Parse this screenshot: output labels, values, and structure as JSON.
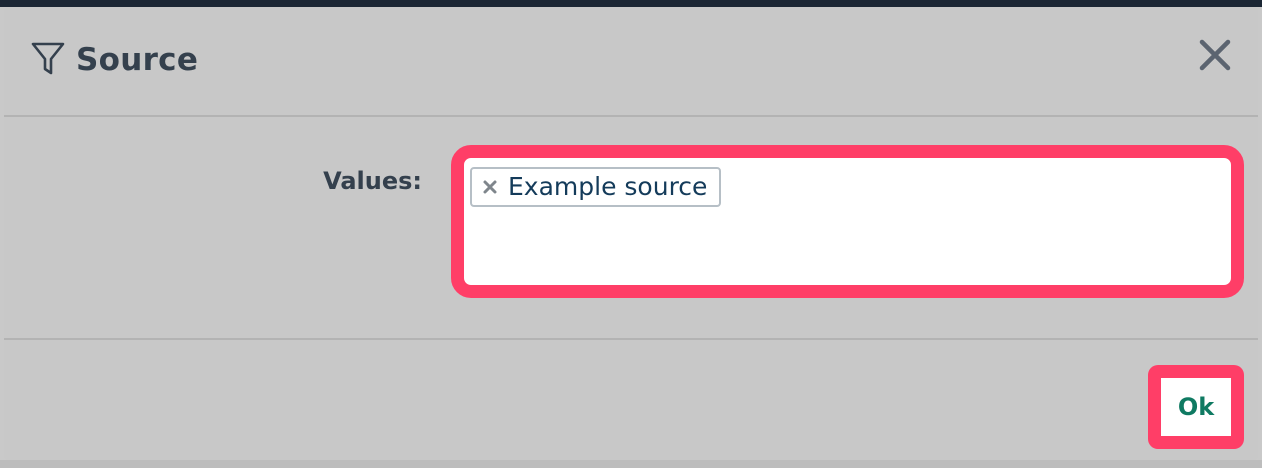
{
  "dialog": {
    "title": "Source",
    "title_icon": "filter-icon",
    "close_icon": "close-icon"
  },
  "form": {
    "values_label": "Values:",
    "selected_values": [
      {
        "label": "Example source",
        "remove_icon": "remove-x-icon"
      }
    ]
  },
  "footer": {
    "ok_label": "Ok"
  },
  "colors": {
    "highlight": "#ff3e67",
    "ok_text": "#0f7a62",
    "title_text": "#34404d",
    "tag_text": "#143b5a"
  }
}
